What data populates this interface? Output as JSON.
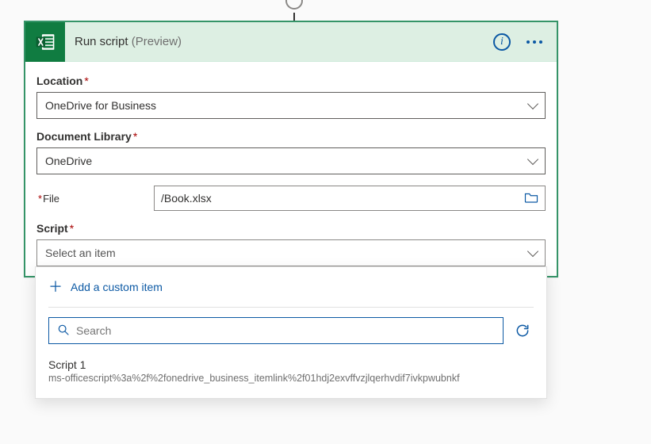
{
  "header": {
    "title": "Run script",
    "suffix": "(Preview)"
  },
  "fields": {
    "location": {
      "label": "Location",
      "value": "OneDrive for Business"
    },
    "doclib": {
      "label": "Document Library",
      "value": "OneDrive"
    },
    "file": {
      "label": "File",
      "value": "/Book.xlsx"
    },
    "script": {
      "label": "Script",
      "placeholder": "Select an item"
    }
  },
  "dropdown": {
    "add_custom": "Add a custom item",
    "search_placeholder": "Search",
    "items": [
      {
        "title": "Script 1",
        "subtitle": "ms-officescript%3a%2f%2fonedrive_business_itemlink%2f01hdj2exvffvzjlqerhvdif7ivkpwubnkf"
      }
    ]
  }
}
